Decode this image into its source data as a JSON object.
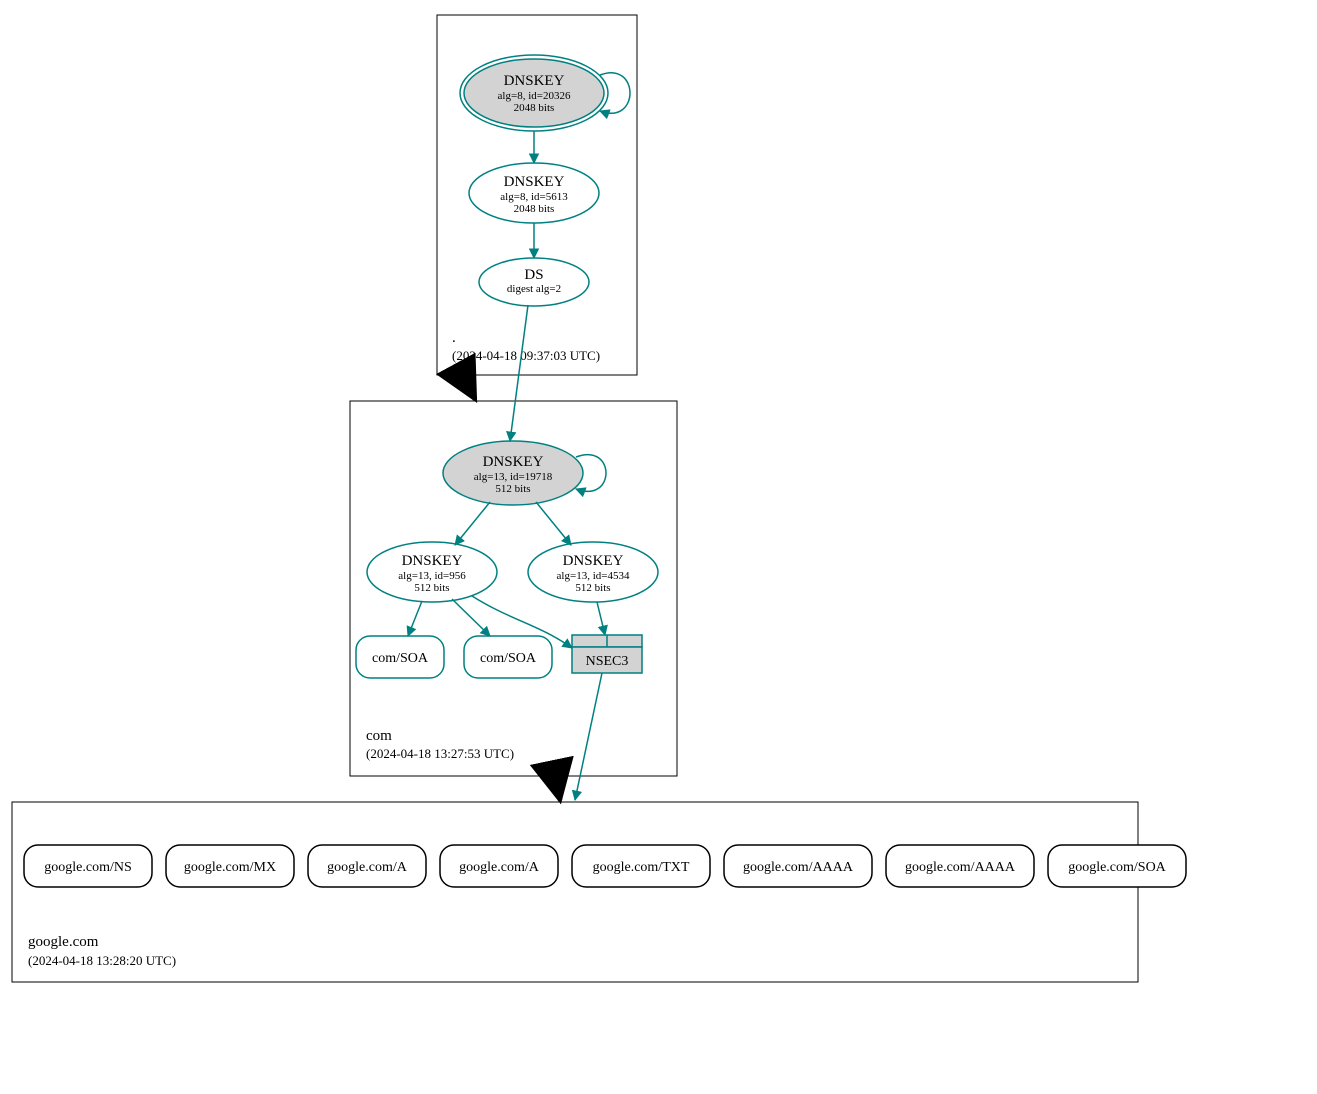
{
  "color_teal": "#008080",
  "color_light_gray": "#d3d3d3",
  "zones": {
    "root": {
      "label": ".",
      "timestamp": "(2024-04-18 09:37:03 UTC)",
      "dnskey1": {
        "title": "DNSKEY",
        "line1": "alg=8, id=20326",
        "line2": "2048 bits"
      },
      "dnskey2": {
        "title": "DNSKEY",
        "line1": "alg=8, id=5613",
        "line2": "2048 bits"
      },
      "ds": {
        "title": "DS",
        "line1": "digest alg=2"
      }
    },
    "com": {
      "label": "com",
      "timestamp": "(2024-04-18 13:27:53 UTC)",
      "dnskey1": {
        "title": "DNSKEY",
        "line1": "alg=13, id=19718",
        "line2": "512 bits"
      },
      "dnskey2": {
        "title": "DNSKEY",
        "line1": "alg=13, id=956",
        "line2": "512 bits"
      },
      "dnskey3": {
        "title": "DNSKEY",
        "line1": "alg=13, id=4534",
        "line2": "512 bits"
      },
      "soa1": "com/SOA",
      "soa2": "com/SOA",
      "nsec3": "NSEC3"
    },
    "google": {
      "label": "google.com",
      "timestamp": "(2024-04-18 13:28:20 UTC)",
      "records": [
        "google.com/NS",
        "google.com/MX",
        "google.com/A",
        "google.com/A",
        "google.com/TXT",
        "google.com/AAAA",
        "google.com/AAAA",
        "google.com/SOA"
      ]
    }
  }
}
